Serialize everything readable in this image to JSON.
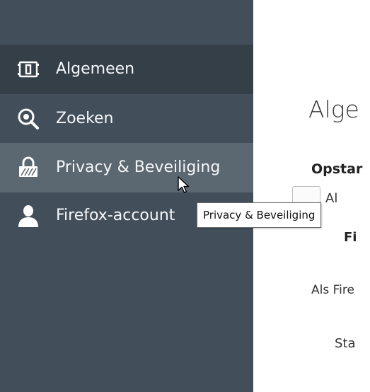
{
  "sidebar": {
    "items": [
      {
        "label": "Algemeen",
        "icon": "general-icon",
        "selected": true
      },
      {
        "label": "Zoeken",
        "icon": "search-icon"
      },
      {
        "label": "Privacy & Beveiliging",
        "icon": "lock-icon",
        "hovered": true
      },
      {
        "label": "Firefox-account",
        "icon": "account-icon"
      }
    ]
  },
  "content": {
    "heading": "Alge",
    "section_title": "Opstar",
    "checkbox_label": "Al",
    "sub_bold": "Fi",
    "description": "Als Fire",
    "description2": "Sta"
  },
  "tooltip": {
    "text": "Privacy & Beveiliging"
  },
  "colors": {
    "sidebar_bg": "#424f5a",
    "selected_bg": "#343f48",
    "hover_bg": "#5b6771",
    "text_light": "#f5f7fa"
  }
}
